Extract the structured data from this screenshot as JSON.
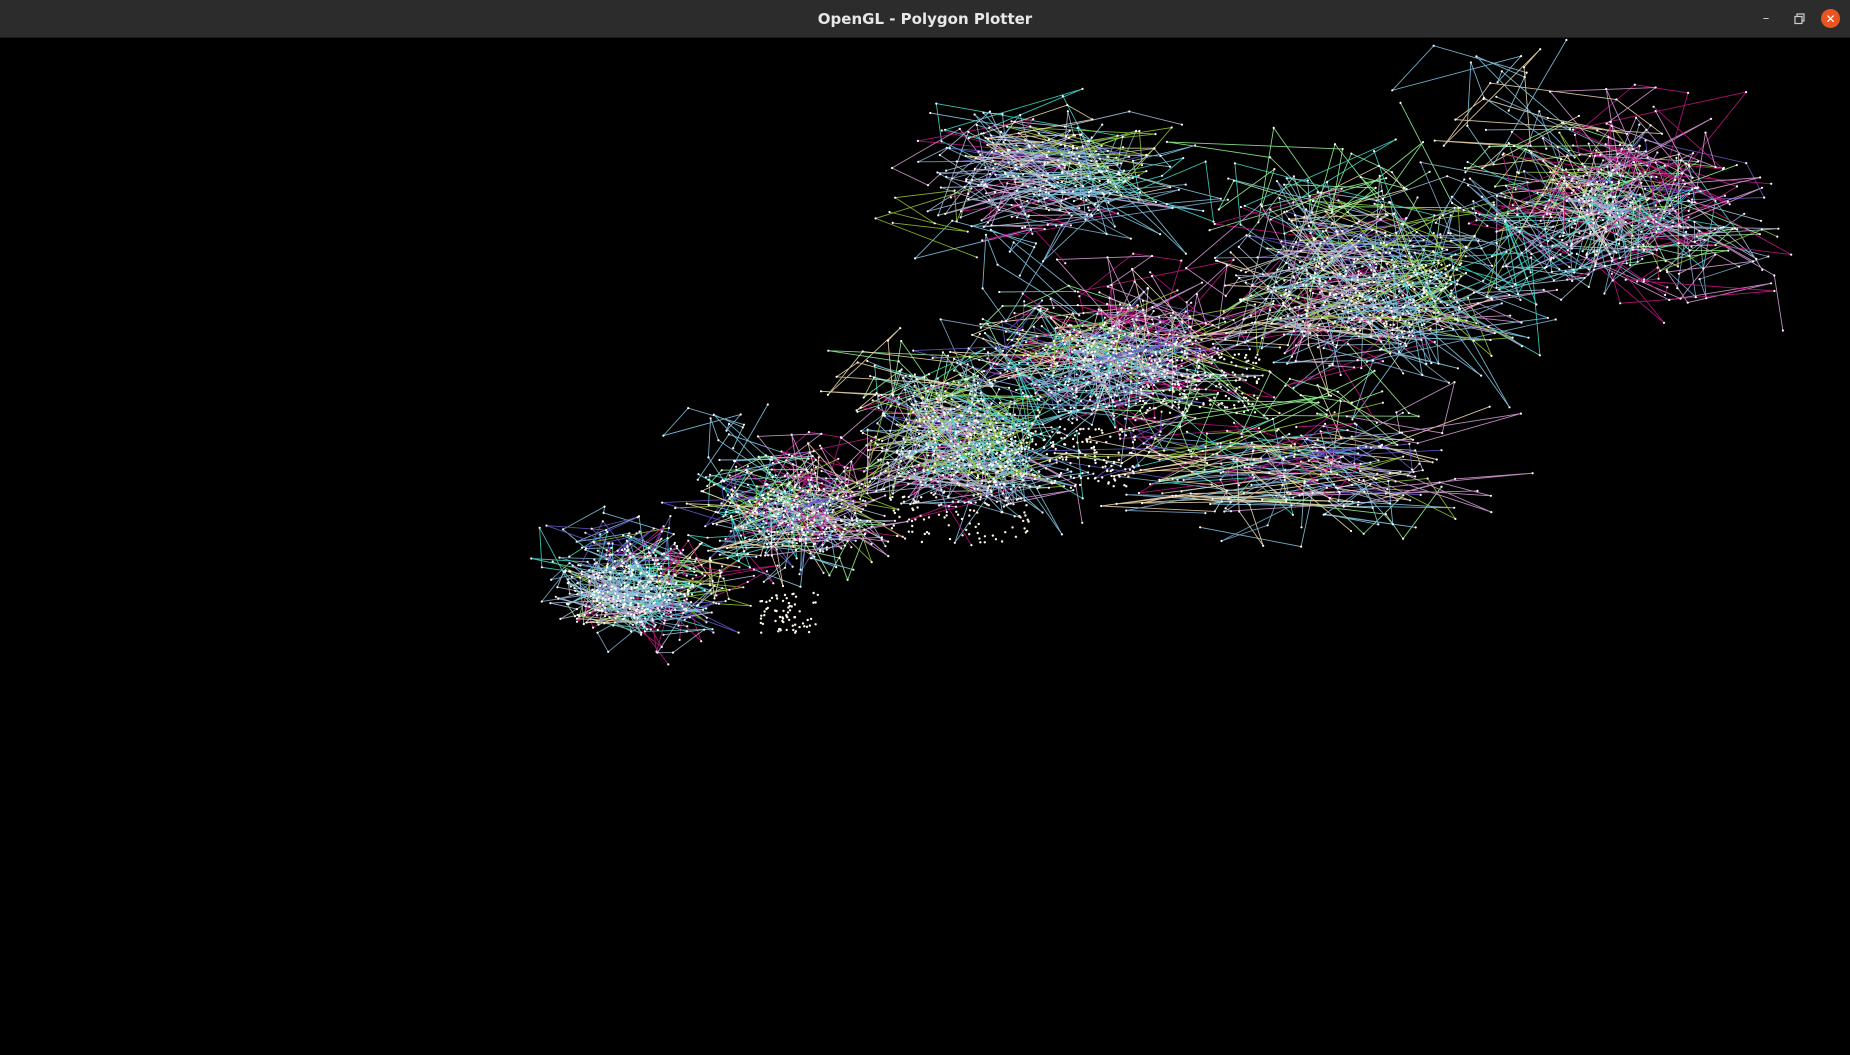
{
  "window": {
    "title": "OpenGL - Polygon Plotter",
    "controls": {
      "minimize_icon": "minimize-icon",
      "maximize_icon": "restore-icon",
      "close_icon": "close-icon"
    },
    "colors": {
      "titlebar_bg": "#2c2c2c",
      "title_text": "#e8e8e8",
      "close_button": "#e95420",
      "canvas_bg": "#000000"
    }
  },
  "plot": {
    "stroke_palette": [
      "#9acd32",
      "#7fb3d5",
      "#c71585",
      "#dda0dd",
      "#98fb98",
      "#87ceeb",
      "#6a5acd",
      "#f5deb3",
      "#40e0d0",
      "#b0c4de"
    ],
    "vertex_color": "#ffffff"
  }
}
